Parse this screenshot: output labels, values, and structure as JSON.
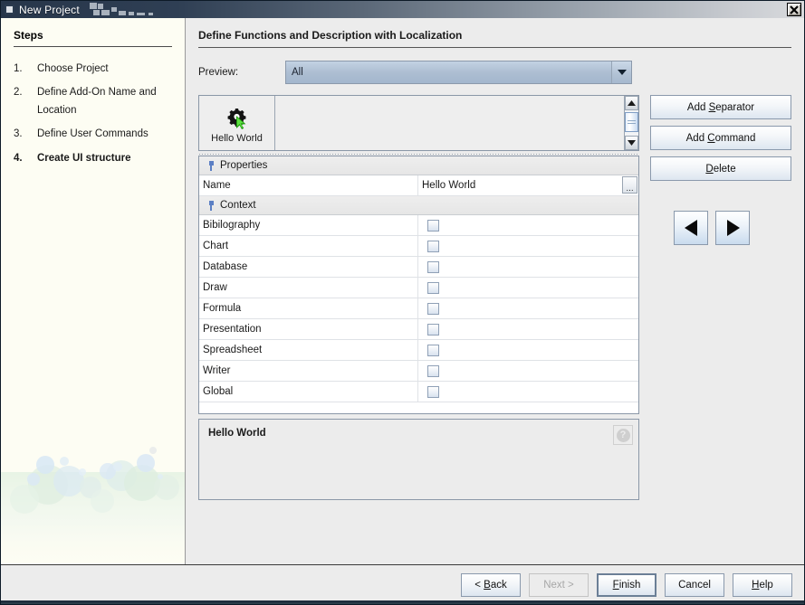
{
  "window": {
    "title": "New Project",
    "close_label": "×",
    "icon": "window-icon"
  },
  "sidebar": {
    "heading": "Steps",
    "steps": [
      {
        "num": "1.",
        "label": "Choose Project",
        "current": false
      },
      {
        "num": "2.",
        "label": "Define Add-On Name and Location",
        "current": false
      },
      {
        "num": "3.",
        "label": "Define User Commands",
        "current": false
      },
      {
        "num": "4.",
        "label": "Create UI structure",
        "current": true
      }
    ]
  },
  "content": {
    "title": "Define Functions and Description with Localization",
    "preview": {
      "label": "Preview:",
      "value": "All",
      "options": [
        "All"
      ]
    },
    "toolbar": {
      "items": [
        {
          "label": "Hello World",
          "icon": "gear-cursor-icon"
        }
      ]
    },
    "properties": {
      "section_label": "Properties",
      "rows": [
        {
          "key": "Name",
          "value": "Hello World",
          "has_ellipsis": true
        }
      ]
    },
    "context": {
      "section_label": "Context",
      "rows": [
        {
          "key": "Bibilography",
          "checked": false
        },
        {
          "key": "Chart",
          "checked": false
        },
        {
          "key": "Database",
          "checked": false
        },
        {
          "key": "Draw",
          "checked": false
        },
        {
          "key": "Formula",
          "checked": false
        },
        {
          "key": "Presentation",
          "checked": false
        },
        {
          "key": "Spreadsheet",
          "checked": false
        },
        {
          "key": "Writer",
          "checked": false
        },
        {
          "key": "Global",
          "checked": false
        }
      ]
    },
    "description": {
      "title": "Hello World",
      "help_glyph": "?"
    },
    "side_buttons": [
      {
        "label": "Add Separator",
        "mnemonic": "S",
        "disabled": false
      },
      {
        "label": "Add Command",
        "mnemonic": "C",
        "disabled": false
      },
      {
        "label": "Delete",
        "mnemonic": "D",
        "disabled": false
      }
    ],
    "move_buttons": [
      {
        "name": "move-left",
        "glyph": "◀"
      },
      {
        "name": "move-right",
        "glyph": "▶"
      }
    ]
  },
  "footer": {
    "buttons": [
      {
        "label": "< Back",
        "mnemonic": "B",
        "disabled": false,
        "focused": false
      },
      {
        "label": "Next >",
        "mnemonic": "N",
        "disabled": true,
        "focused": false
      },
      {
        "label": "Finish",
        "mnemonic": "F",
        "disabled": false,
        "focused": true
      },
      {
        "label": "Cancel",
        "mnemonic": "",
        "disabled": false,
        "focused": false
      },
      {
        "label": "Help",
        "mnemonic": "H",
        "disabled": false,
        "focused": false
      }
    ]
  },
  "colors": {
    "titlebar_dark": "#27364a",
    "panel_bg": "#ececec",
    "steps_bg": "#fdfdf3",
    "combo_bg": "#adbed2",
    "accent_icon_green": "#3fbf2f"
  }
}
